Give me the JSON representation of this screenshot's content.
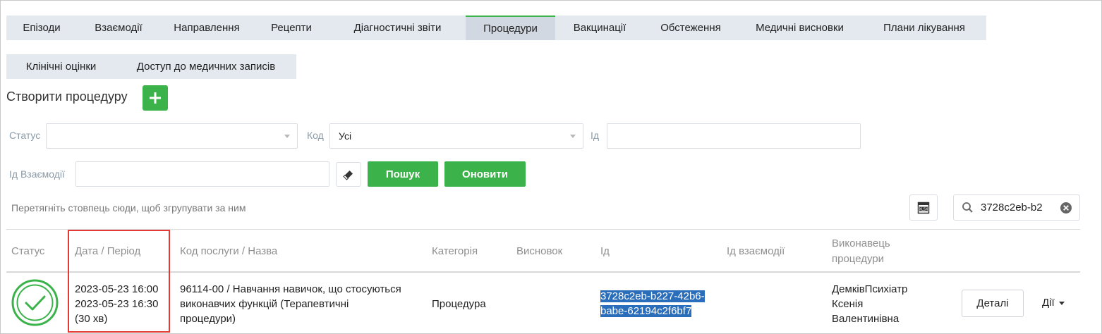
{
  "tabs_row1": [
    {
      "label": "Епізоди",
      "active": false
    },
    {
      "label": "Взаємодії",
      "active": false
    },
    {
      "label": "Направлення",
      "active": false
    },
    {
      "label": "Рецепти",
      "active": false
    },
    {
      "label": "Діагностичні звіти",
      "active": false
    },
    {
      "label": "Процедури",
      "active": true
    },
    {
      "label": "Вакцинації",
      "active": false
    },
    {
      "label": "Обстеження",
      "active": false
    },
    {
      "label": "Медичні висновки",
      "active": false
    },
    {
      "label": "Плани лікування",
      "active": false
    }
  ],
  "tabs_row2": [
    {
      "label": "Клінічні оцінки",
      "active": false
    },
    {
      "label": "Доступ до медичних записів",
      "active": false
    }
  ],
  "create": {
    "label": "Створити процедуру",
    "button_icon": "plus-icon"
  },
  "filters": {
    "status_label": "Статус",
    "status_value": "",
    "code_label": "Код",
    "code_value": "Усі",
    "id_label": "Ід",
    "id_value": "",
    "interaction_id_label": "Ід Взаємодії",
    "interaction_id_value": "",
    "search_button": "Пошук",
    "refresh_button": "Оновити"
  },
  "grid": {
    "group_hint": "Перетягніть стовпець сюди, щоб згрупувати за ним",
    "search_value": "3728c2eb-b2",
    "columns": {
      "status": "Статус",
      "date": "Дата / Період",
      "code": "Код послуги / Назва",
      "category": "Категорія",
      "conclusion": "Висновок",
      "id": "Ід",
      "interaction_id": "Ід взаємодії",
      "performer_line1": "Виконавець",
      "performer_line2": "процедури"
    },
    "rows": [
      {
        "status_icon": "check-circle-icon",
        "date_start": "2023-05-23 16:00",
        "date_end": "2023-05-23 16:30",
        "duration": "(30 хв)",
        "code_line1": "96114-00 / Навчання навичок, що стосуються",
        "code_line2": "виконавчих функцій (Терапевтичні",
        "code_line3": "процедури)",
        "category": "Процедура",
        "conclusion": "",
        "id_line1": "3728c2eb-b227-42b6-",
        "id_line2": "babe-62194c2f6bf7",
        "interaction_id": "",
        "performer_line1": "ДемківПсихіатр",
        "performer_line2": "Ксенія",
        "performer_line3": "Валентинівна",
        "details_button": "Деталі",
        "actions_label": "Дії"
      }
    ]
  },
  "colors": {
    "accent_green": "#3cb34a",
    "tab_bg": "#e4e9f0",
    "selection_blue": "#2a6ebb",
    "highlight_red": "#e53935"
  }
}
